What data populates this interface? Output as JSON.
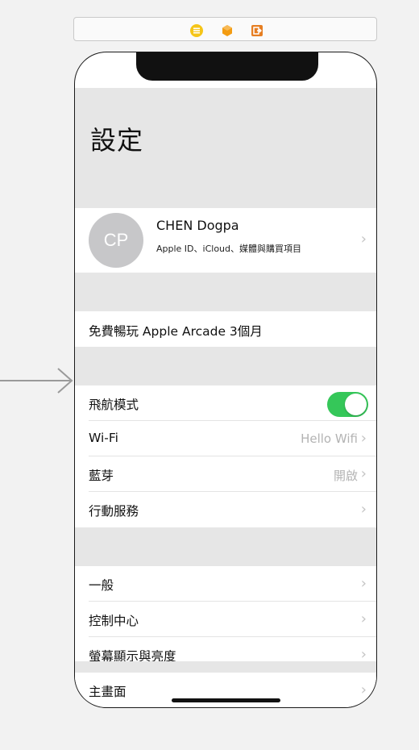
{
  "scene_icons": [
    {
      "name": "view-controller-icon",
      "color": "#f5c518"
    },
    {
      "name": "first-responder-icon",
      "color": "#f39c12"
    },
    {
      "name": "exit-icon",
      "color": "#e67e22"
    }
  ],
  "settings": {
    "title": "設定",
    "profile": {
      "initials": "CP",
      "name": "CHEN Dogpa",
      "subtitle": "Apple ID、iCloud、媒體與購買項目"
    },
    "arcade_label": "免費暢玩 Apple Arcade 3個月",
    "group1": [
      {
        "label": "飛航模式",
        "value": "",
        "toggle": true
      },
      {
        "label": "Wi-Fi",
        "value": "Hello Wifi"
      },
      {
        "label": "藍芽",
        "value": "開啟"
      },
      {
        "label": "行動服務",
        "value": ""
      }
    ],
    "group2": [
      {
        "label": "一般"
      },
      {
        "label": "控制中心"
      },
      {
        "label": "螢幕顯示與亮度"
      },
      {
        "label": "主畫面"
      }
    ]
  },
  "colors": {
    "toggle_on": "#35c759",
    "background_gray": "#e6e6e6"
  }
}
